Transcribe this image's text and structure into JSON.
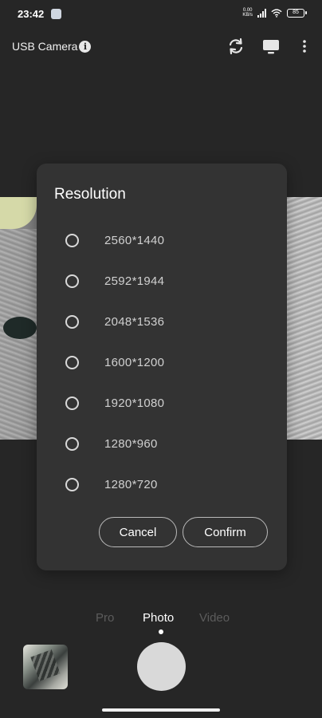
{
  "status_bar": {
    "time": "23:42",
    "net_speed_top": "0.00",
    "net_speed_bottom": "KB/s",
    "battery": "85"
  },
  "toolbar": {
    "title": "USB Camera",
    "info_icon": "i",
    "icons": [
      "switch-camera-icon",
      "display-icon",
      "more-vert-icon"
    ]
  },
  "dialog": {
    "title": "Resolution",
    "options": [
      {
        "label": "2560*1440",
        "selected": false
      },
      {
        "label": "2592*1944",
        "selected": false
      },
      {
        "label": "2048*1536",
        "selected": false
      },
      {
        "label": "1600*1200",
        "selected": false
      },
      {
        "label": "1920*1080",
        "selected": false
      },
      {
        "label": "1280*960",
        "selected": false
      },
      {
        "label": "1280*720",
        "selected": false
      }
    ],
    "cancel_label": "Cancel",
    "confirm_label": "Confirm"
  },
  "modes": {
    "items": [
      "Pro",
      "Photo",
      "Video"
    ],
    "active": "Photo"
  },
  "colors": {
    "background": "#262626",
    "dialog": "#333333",
    "inactive_mode": "#5c5c5c",
    "shutter": "#d9d9d9"
  }
}
